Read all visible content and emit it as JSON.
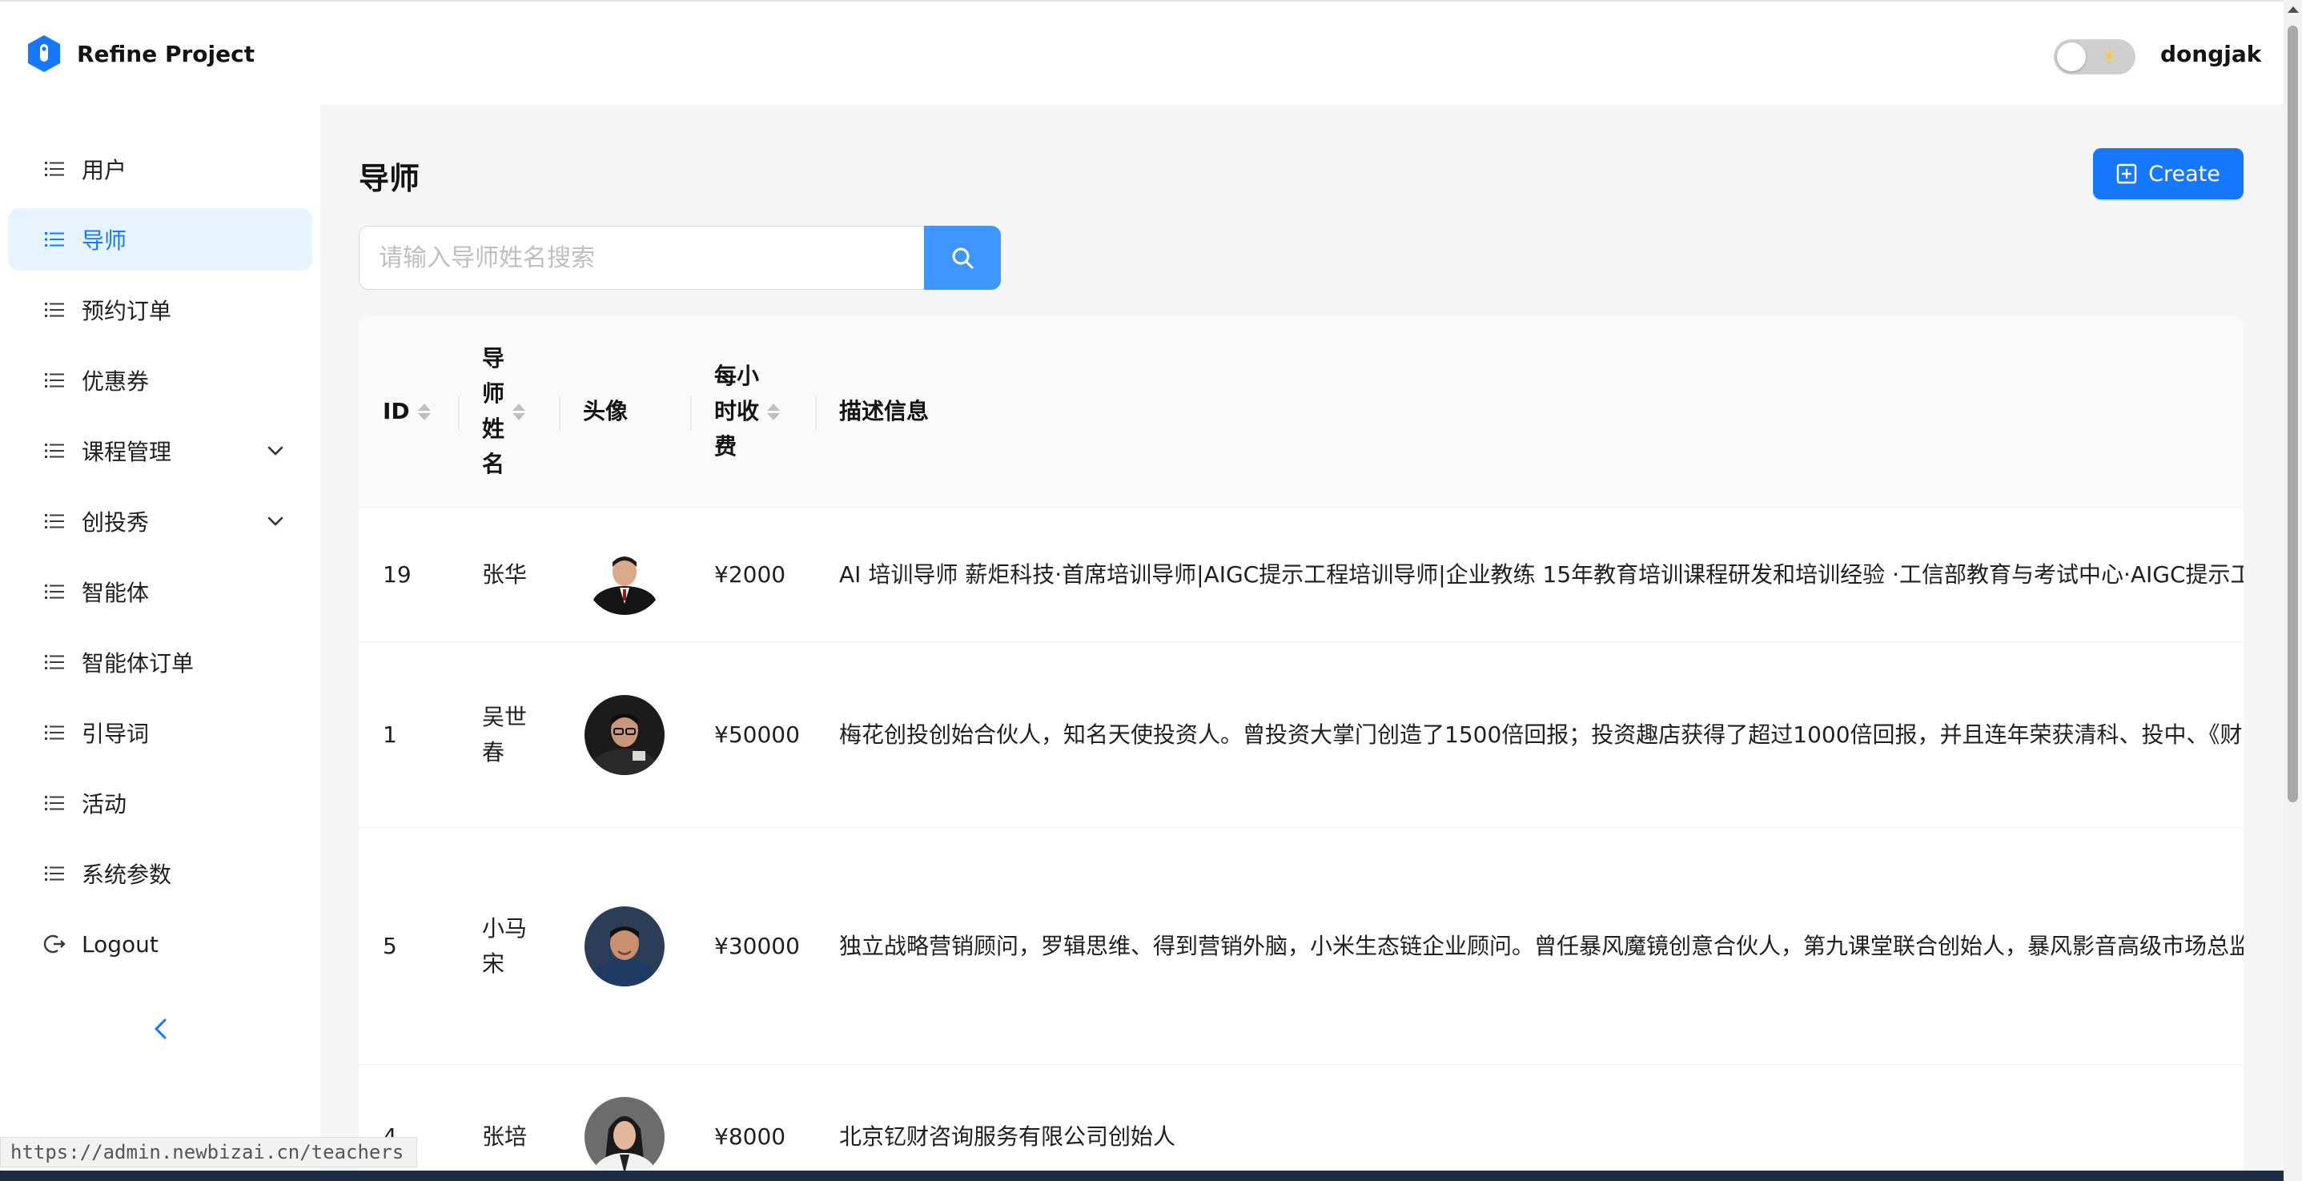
{
  "app": {
    "title": "Refine Project",
    "username": "dongjak",
    "theme_icon": "sun-icon"
  },
  "sidebar": {
    "items": [
      {
        "label": "用户",
        "icon": "list-icon",
        "active": false
      },
      {
        "label": "导师",
        "icon": "list-icon",
        "active": true
      },
      {
        "label": "预约订单",
        "icon": "list-icon",
        "active": false
      },
      {
        "label": "优惠券",
        "icon": "list-icon",
        "active": false
      },
      {
        "label": "课程管理",
        "icon": "list-icon",
        "active": false,
        "expandable": true
      },
      {
        "label": "创投秀",
        "icon": "list-icon",
        "active": false,
        "expandable": true
      },
      {
        "label": "智能体",
        "icon": "list-icon",
        "active": false
      },
      {
        "label": "智能体订单",
        "icon": "list-icon",
        "active": false
      },
      {
        "label": "引导词",
        "icon": "list-icon",
        "active": false
      },
      {
        "label": "活动",
        "icon": "list-icon",
        "active": false
      },
      {
        "label": "系统参数",
        "icon": "list-icon",
        "active": false
      },
      {
        "label": "Logout",
        "icon": "logout-icon",
        "active": false
      }
    ],
    "collapse_icon": "chevron-left-icon"
  },
  "status_bar": {
    "url": "https://admin.newbizai.cn/teachers"
  },
  "main": {
    "title": "导师",
    "create_label": "Create",
    "search": {
      "placeholder": "请输入导师姓名搜索",
      "value": ""
    },
    "table": {
      "columns": [
        "ID",
        "导师姓名",
        "头像",
        "每小时收费",
        "描述信息"
      ],
      "column_lines": [
        [
          "ID"
        ],
        [
          "导",
          "师",
          "姓",
          "名"
        ],
        [
          "头像"
        ],
        [
          "每小",
          "时收",
          "费"
        ],
        [
          "描述信息"
        ]
      ],
      "rows": [
        {
          "id": "19",
          "name_lines": [
            "张华"
          ],
          "avatar": "avatar-man-suit",
          "fee": "¥2000",
          "desc": "AI 培训导师 薪炬科技·首席培训导师|AIGC提示工程培训导师|企业教练 15年教育培训课程研发和培训经验 ·工信部教育与考试中心·AIGC提示工程"
        },
        {
          "id": "1",
          "name_lines": [
            "吴世",
            "春"
          ],
          "avatar": "avatar-man-glasses",
          "fee": "¥50000",
          "desc": "梅花创投创始合伙人，知名天使投资人。曾投资大掌门创造了1500倍回报；投资趣店获得了超过1000倍回报，并且连年荣获清科、投中、《财富"
        },
        {
          "id": "5",
          "name_lines": [
            "小马",
            "宋"
          ],
          "avatar": "avatar-man-smiling",
          "fee": "¥30000",
          "desc": "独立战略营销顾问，罗辑思维、得到营销外脑，小米生态链企业顾问。曾任暴风魔镜创意合伙人，第九课堂联合创始人，暴风影音高级市场总监"
        },
        {
          "id": "4",
          "name_lines": [
            "张培"
          ],
          "avatar": "avatar-woman",
          "fee": "¥8000",
          "desc": "北京钇财咨询服务有限公司创始人"
        }
      ]
    }
  },
  "colors": {
    "primary": "#1677ff",
    "search_button": "#4096ff",
    "active_bg": "#e6f4ff",
    "content_bg": "#f5f5f5"
  }
}
